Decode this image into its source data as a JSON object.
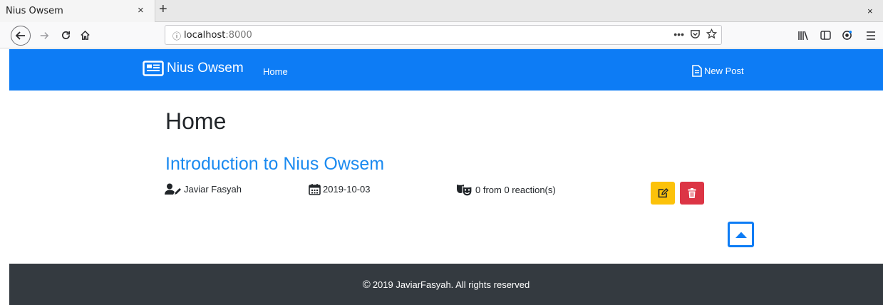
{
  "browser": {
    "tab_title": "Nius Owsem",
    "tab_close": "×",
    "new_tab": "+",
    "window_close": "×",
    "url_host": "localhost",
    "url_port": ":8000",
    "url_actions": {
      "more": "•••"
    }
  },
  "navbar": {
    "brand": "Nius Owsem",
    "home": "Home",
    "new_post": "New Post",
    "background": "#0d7cf5"
  },
  "main": {
    "page_title": "Home",
    "posts": [
      {
        "title": "Introduction to Nius Owsem",
        "author": "Javiar Fasyah",
        "date": "2019-10-03",
        "reactions": "0 from 0 reaction(s)"
      }
    ]
  },
  "footer": {
    "copyright_symbol": "©",
    "text": "2019 JaviarFasyah. All rights reserved"
  },
  "icons": {
    "brand": "newspaper-icon",
    "new_post": "file-alt-icon",
    "author": "user-edit-icon",
    "date": "calendar-icon",
    "reactions": "theater-masks-icon",
    "edit": "edit-icon",
    "delete": "trash-icon",
    "scroll_top": "caret-square-up-icon"
  },
  "colors": {
    "edit_button": "#fcc20a",
    "delete_button": "#dc3545",
    "link": "#1a8af0",
    "footer": "#343a40"
  }
}
